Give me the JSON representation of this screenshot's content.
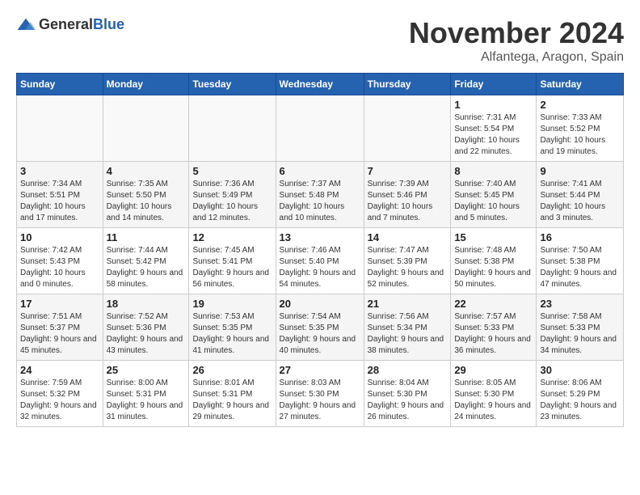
{
  "logo": {
    "text_general": "General",
    "text_blue": "Blue"
  },
  "header": {
    "month_title": "November 2024",
    "subtitle": "Alfantega, Aragon, Spain"
  },
  "weekdays": [
    "Sunday",
    "Monday",
    "Tuesday",
    "Wednesday",
    "Thursday",
    "Friday",
    "Saturday"
  ],
  "weeks": [
    [
      {
        "day": "",
        "sunrise": "",
        "sunset": "",
        "daylight": ""
      },
      {
        "day": "",
        "sunrise": "",
        "sunset": "",
        "daylight": ""
      },
      {
        "day": "",
        "sunrise": "",
        "sunset": "",
        "daylight": ""
      },
      {
        "day": "",
        "sunrise": "",
        "sunset": "",
        "daylight": ""
      },
      {
        "day": "",
        "sunrise": "",
        "sunset": "",
        "daylight": ""
      },
      {
        "day": "1",
        "sunrise": "Sunrise: 7:31 AM",
        "sunset": "Sunset: 5:54 PM",
        "daylight": "Daylight: 10 hours and 22 minutes."
      },
      {
        "day": "2",
        "sunrise": "Sunrise: 7:33 AM",
        "sunset": "Sunset: 5:52 PM",
        "daylight": "Daylight: 10 hours and 19 minutes."
      }
    ],
    [
      {
        "day": "3",
        "sunrise": "Sunrise: 7:34 AM",
        "sunset": "Sunset: 5:51 PM",
        "daylight": "Daylight: 10 hours and 17 minutes."
      },
      {
        "day": "4",
        "sunrise": "Sunrise: 7:35 AM",
        "sunset": "Sunset: 5:50 PM",
        "daylight": "Daylight: 10 hours and 14 minutes."
      },
      {
        "day": "5",
        "sunrise": "Sunrise: 7:36 AM",
        "sunset": "Sunset: 5:49 PM",
        "daylight": "Daylight: 10 hours and 12 minutes."
      },
      {
        "day": "6",
        "sunrise": "Sunrise: 7:37 AM",
        "sunset": "Sunset: 5:48 PM",
        "daylight": "Daylight: 10 hours and 10 minutes."
      },
      {
        "day": "7",
        "sunrise": "Sunrise: 7:39 AM",
        "sunset": "Sunset: 5:46 PM",
        "daylight": "Daylight: 10 hours and 7 minutes."
      },
      {
        "day": "8",
        "sunrise": "Sunrise: 7:40 AM",
        "sunset": "Sunset: 5:45 PM",
        "daylight": "Daylight: 10 hours and 5 minutes."
      },
      {
        "day": "9",
        "sunrise": "Sunrise: 7:41 AM",
        "sunset": "Sunset: 5:44 PM",
        "daylight": "Daylight: 10 hours and 3 minutes."
      }
    ],
    [
      {
        "day": "10",
        "sunrise": "Sunrise: 7:42 AM",
        "sunset": "Sunset: 5:43 PM",
        "daylight": "Daylight: 10 hours and 0 minutes."
      },
      {
        "day": "11",
        "sunrise": "Sunrise: 7:44 AM",
        "sunset": "Sunset: 5:42 PM",
        "daylight": "Daylight: 9 hours and 58 minutes."
      },
      {
        "day": "12",
        "sunrise": "Sunrise: 7:45 AM",
        "sunset": "Sunset: 5:41 PM",
        "daylight": "Daylight: 9 hours and 56 minutes."
      },
      {
        "day": "13",
        "sunrise": "Sunrise: 7:46 AM",
        "sunset": "Sunset: 5:40 PM",
        "daylight": "Daylight: 9 hours and 54 minutes."
      },
      {
        "day": "14",
        "sunrise": "Sunrise: 7:47 AM",
        "sunset": "Sunset: 5:39 PM",
        "daylight": "Daylight: 9 hours and 52 minutes."
      },
      {
        "day": "15",
        "sunrise": "Sunrise: 7:48 AM",
        "sunset": "Sunset: 5:38 PM",
        "daylight": "Daylight: 9 hours and 50 minutes."
      },
      {
        "day": "16",
        "sunrise": "Sunrise: 7:50 AM",
        "sunset": "Sunset: 5:38 PM",
        "daylight": "Daylight: 9 hours and 47 minutes."
      }
    ],
    [
      {
        "day": "17",
        "sunrise": "Sunrise: 7:51 AM",
        "sunset": "Sunset: 5:37 PM",
        "daylight": "Daylight: 9 hours and 45 minutes."
      },
      {
        "day": "18",
        "sunrise": "Sunrise: 7:52 AM",
        "sunset": "Sunset: 5:36 PM",
        "daylight": "Daylight: 9 hours and 43 minutes."
      },
      {
        "day": "19",
        "sunrise": "Sunrise: 7:53 AM",
        "sunset": "Sunset: 5:35 PM",
        "daylight": "Daylight: 9 hours and 41 minutes."
      },
      {
        "day": "20",
        "sunrise": "Sunrise: 7:54 AM",
        "sunset": "Sunset: 5:35 PM",
        "daylight": "Daylight: 9 hours and 40 minutes."
      },
      {
        "day": "21",
        "sunrise": "Sunrise: 7:56 AM",
        "sunset": "Sunset: 5:34 PM",
        "daylight": "Daylight: 9 hours and 38 minutes."
      },
      {
        "day": "22",
        "sunrise": "Sunrise: 7:57 AM",
        "sunset": "Sunset: 5:33 PM",
        "daylight": "Daylight: 9 hours and 36 minutes."
      },
      {
        "day": "23",
        "sunrise": "Sunrise: 7:58 AM",
        "sunset": "Sunset: 5:33 PM",
        "daylight": "Daylight: 9 hours and 34 minutes."
      }
    ],
    [
      {
        "day": "24",
        "sunrise": "Sunrise: 7:59 AM",
        "sunset": "Sunset: 5:32 PM",
        "daylight": "Daylight: 9 hours and 32 minutes."
      },
      {
        "day": "25",
        "sunrise": "Sunrise: 8:00 AM",
        "sunset": "Sunset: 5:31 PM",
        "daylight": "Daylight: 9 hours and 31 minutes."
      },
      {
        "day": "26",
        "sunrise": "Sunrise: 8:01 AM",
        "sunset": "Sunset: 5:31 PM",
        "daylight": "Daylight: 9 hours and 29 minutes."
      },
      {
        "day": "27",
        "sunrise": "Sunrise: 8:03 AM",
        "sunset": "Sunset: 5:30 PM",
        "daylight": "Daylight: 9 hours and 27 minutes."
      },
      {
        "day": "28",
        "sunrise": "Sunrise: 8:04 AM",
        "sunset": "Sunset: 5:30 PM",
        "daylight": "Daylight: 9 hours and 26 minutes."
      },
      {
        "day": "29",
        "sunrise": "Sunrise: 8:05 AM",
        "sunset": "Sunset: 5:30 PM",
        "daylight": "Daylight: 9 hours and 24 minutes."
      },
      {
        "day": "30",
        "sunrise": "Sunrise: 8:06 AM",
        "sunset": "Sunset: 5:29 PM",
        "daylight": "Daylight: 9 hours and 23 minutes."
      }
    ]
  ]
}
